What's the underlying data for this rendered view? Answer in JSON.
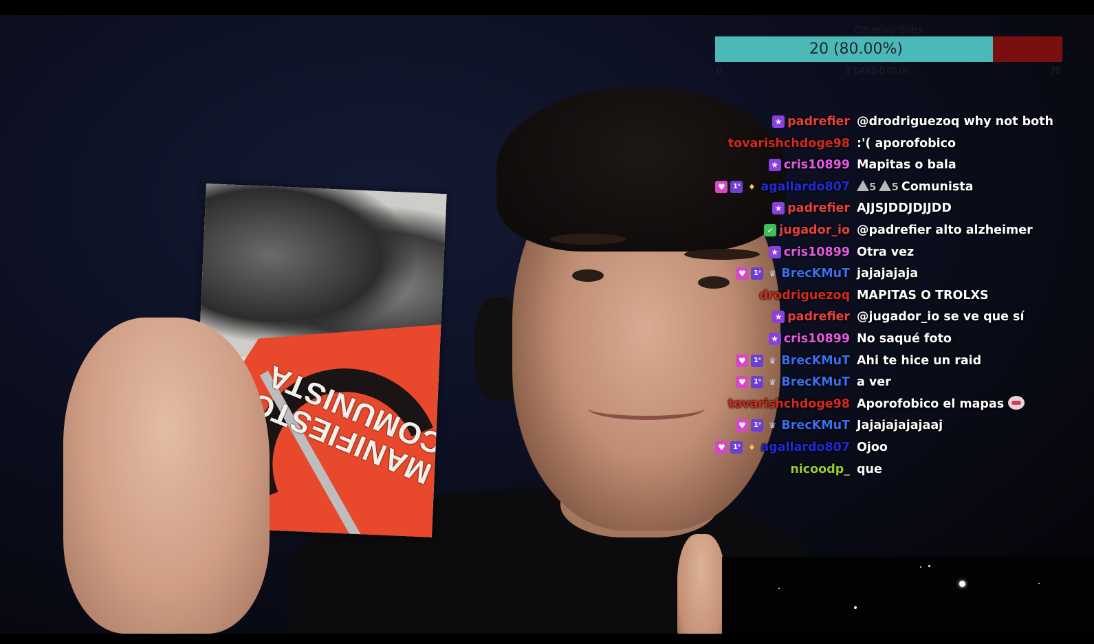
{
  "goal": {
    "caption": "Objetivo Subs",
    "value_text": "20 (80.00%)",
    "progress": 0.8,
    "min_label": "0",
    "max_label": "25",
    "sub_label": "2 DAYS 0:00:00",
    "fill_color": "#4ab9b7",
    "track_color": "#7a0f0f"
  },
  "chat": {
    "messages": [
      {
        "user": "padrefier",
        "color": "#e8413c",
        "badges": [
          "star-badge"
        ],
        "text": "@drodriguezoq why not both"
      },
      {
        "user": "tovarishchdoge98",
        "color": "#d62a1d",
        "badges": [],
        "text": ":'( aporofobico"
      },
      {
        "user": "cris10899",
        "color": "#e45be2",
        "badges": [
          "star-badge"
        ],
        "text": "Mapitas o bala"
      },
      {
        "user": "agallardo807",
        "color": "#1f2bd6",
        "badges": [
          "heart-badge",
          "sub-badge",
          "gem-badge"
        ],
        "text": "Comunista",
        "prefix": "5 5"
      },
      {
        "user": "padrefier",
        "color": "#e8413c",
        "badges": [
          "star-badge"
        ],
        "text": "AJJSJDDJDJJDD"
      },
      {
        "user": "jugador_io",
        "color": "#e8413c",
        "badges": [
          "green-badge"
        ],
        "text": "@padrefier alto alzheimer"
      },
      {
        "user": "cris10899",
        "color": "#e45be2",
        "badges": [
          "star-badge"
        ],
        "text": "Otra vez"
      },
      {
        "user": "BrecKMuT",
        "color": "#3a6ff0",
        "badges": [
          "heart-badge",
          "sub-badge",
          "crown-badge"
        ],
        "text": "jajajajaja"
      },
      {
        "user": "drodriguezoq",
        "color": "#d62a1d",
        "badges": [],
        "text": "MAPITAS O TROLXS"
      },
      {
        "user": "padrefier",
        "color": "#e8413c",
        "badges": [
          "star-badge"
        ],
        "text": "@jugador_io se ve que sí"
      },
      {
        "user": "cris10899",
        "color": "#e45be2",
        "badges": [
          "star-badge"
        ],
        "text": "No saqué foto"
      },
      {
        "user": "BrecKMuT",
        "color": "#3a6ff0",
        "badges": [
          "heart-badge",
          "sub-badge",
          "crown-badge"
        ],
        "text": "Ahi te hice un raid"
      },
      {
        "user": "BrecKMuT",
        "color": "#3a6ff0",
        "badges": [
          "heart-badge",
          "sub-badge",
          "crown-badge"
        ],
        "text": "a ver"
      },
      {
        "user": "tovarishchdoge98",
        "color": "#d62a1d",
        "badges": [],
        "text": "Aporofobico el mapas",
        "emote": "pout-emote"
      },
      {
        "user": "BrecKMuT",
        "color": "#3a6ff0",
        "badges": [
          "heart-badge",
          "sub-badge",
          "crown-badge"
        ],
        "text": "Jajajajajajaaj"
      },
      {
        "user": "agallardo807",
        "color": "#1f2bd6",
        "badges": [
          "heart-badge",
          "sub-badge",
          "gem-badge"
        ],
        "text": "Ojoo"
      },
      {
        "user": "nicoodp_",
        "color": "#9acd32",
        "badges": [],
        "text": "que"
      }
    ]
  },
  "book": {
    "title_line1": "MANIFIESTO",
    "title_line2": "COMUNISTA"
  }
}
